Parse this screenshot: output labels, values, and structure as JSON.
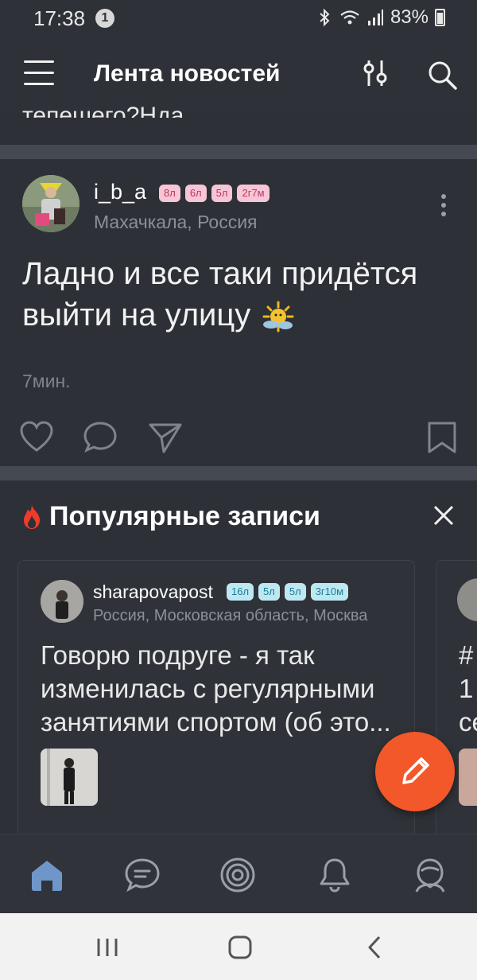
{
  "status_bar": {
    "time": "17:38",
    "notification_count": "1",
    "battery": "83%"
  },
  "app_bar": {
    "title": "Лента новостей",
    "cut_text": "тепешего?Нда"
  },
  "post": {
    "username": "i_b_a",
    "badges": [
      "8л",
      "6л",
      "5л",
      "2г7м"
    ],
    "location": "Махачкала, Россия",
    "text": "Ладно и все таки придётся выйти на улицу",
    "time": "7мин."
  },
  "popular": {
    "title": "Популярные записи",
    "card": {
      "username": "sharapovapost",
      "badges": [
        "16л",
        "5л",
        "5л",
        "3г10м"
      ],
      "location": "Россия, Московская область, Москва",
      "text": "Говорю подруге - я так изменилась с регулярными занятиями спортом (об это..."
    },
    "card2_text": "# 1 се"
  },
  "colors": {
    "background": "#2d3036",
    "accent": "#f2582a",
    "badge_pink_bg": "#f7c5d6",
    "badge_cyan_bg": "#bde8f2"
  },
  "icons": {
    "bottom_nav": [
      "home-icon",
      "chat-icon",
      "target-icon",
      "bell-icon",
      "profile-icon"
    ]
  }
}
